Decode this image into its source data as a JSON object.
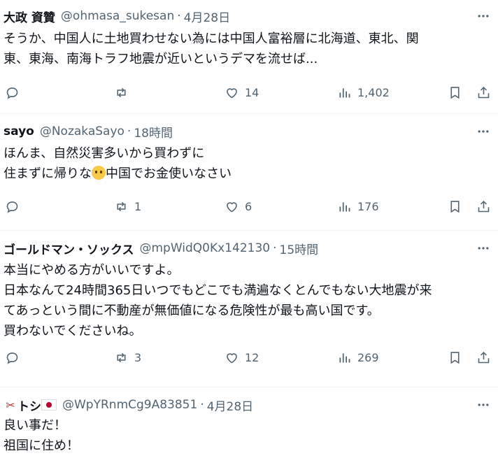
{
  "tweets": [
    {
      "name": "大政 資贊",
      "handle": "@ohmasa_sukesan",
      "time": "4月28日",
      "lines": [
        "そうか、中国人に土地買わせない為には中国人富裕層に北海道、東北、関",
        "東、東海、南海トラフ地震が近いというデマを流せば..."
      ],
      "replies": "",
      "reposts": "",
      "likes": "14",
      "views": "1,402"
    },
    {
      "name": "sayo",
      "handle": "@NozakaSayo",
      "time": "18時間",
      "lines": [
        "ほんま、自然災害多いから買わずに",
        "住まずに帰りな",
        "中国でお金使いなさい"
      ],
      "replies": "",
      "reposts": "1",
      "likes": "6",
      "views": "176"
    },
    {
      "name": "ゴールドマン・ソックス",
      "handle": "@mpWidQ0Kx142130",
      "time": "15時間",
      "lines": [
        "本当にやめる方がいいですよ。",
        "日本なんて24時間365日いつでもどこでも満遍なくとんでもない大地震が来",
        "てあっという間に不動産が無価値になる危険性が最も高い国です。",
        "買わないでくださいね。"
      ],
      "replies": "",
      "reposts": "3",
      "likes": "12",
      "views": "269"
    },
    {
      "name": "トシ",
      "handle": "@WpYRnmCg9A83851",
      "time": "4月28日",
      "lines": [
        "良い事だ！",
        "祖国に住め！"
      ]
    }
  ],
  "separator": "·",
  "colors": {
    "text": "#0f1419",
    "secondary": "#536471",
    "border": "#eff3f4"
  },
  "icons": [
    "more-icon",
    "reply-icon",
    "repost-icon",
    "like-icon",
    "views-icon",
    "bookmark-icon",
    "share-icon",
    "scissors-icon",
    "japan-flag-icon",
    "pleading-face-emoji"
  ]
}
